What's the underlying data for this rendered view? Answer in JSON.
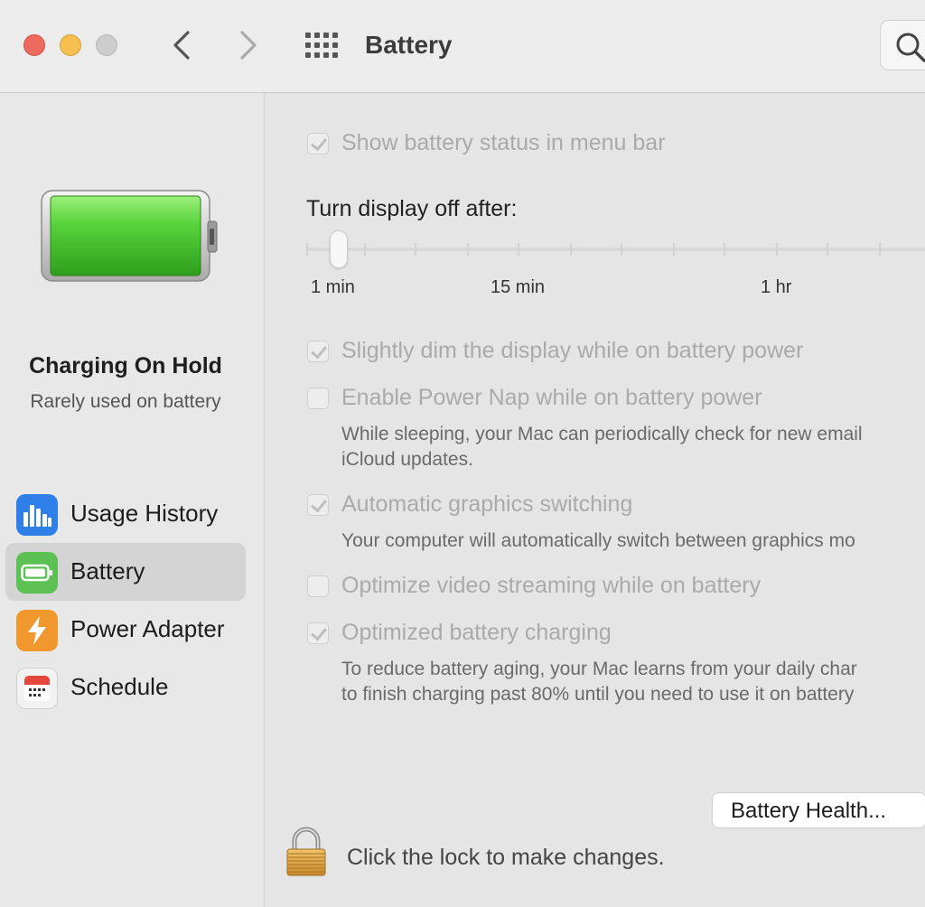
{
  "window": {
    "title": "Battery"
  },
  "sidebar": {
    "status_title": "Charging On Hold",
    "status_subtitle": "Rarely used on battery",
    "items": [
      {
        "label": "Usage History",
        "icon": "bar-chart-icon",
        "color": "#2f7fe8"
      },
      {
        "label": "Battery",
        "icon": "battery-icon",
        "color": "#5cc152",
        "selected": true
      },
      {
        "label": "Power Adapter",
        "icon": "lightning-icon",
        "color": "#f0982e"
      },
      {
        "label": "Schedule",
        "icon": "calendar-icon",
        "color": "#e5463c"
      }
    ]
  },
  "main": {
    "show_status": {
      "label": "Show battery status in menu bar",
      "checked": true
    },
    "display_off": {
      "label": "Turn display off after:",
      "tick_labels": [
        "1 min",
        "15 min",
        "1 hr"
      ],
      "value": "1 min"
    },
    "dim_display": {
      "label": "Slightly dim the display while on battery power",
      "checked": true
    },
    "power_nap": {
      "label": "Enable Power Nap while on battery power",
      "checked": false,
      "description_line1": "While sleeping, your Mac can periodically check for new email",
      "description_line2": "iCloud updates."
    },
    "graphics_switching": {
      "label": "Automatic graphics switching",
      "checked": true,
      "description": "Your computer will automatically switch between graphics mo"
    },
    "video_streaming": {
      "label": "Optimize video streaming while on battery",
      "checked": false
    },
    "optimized_charging": {
      "label": "Optimized battery charging",
      "checked": true,
      "description_line1": "To reduce battery aging, your Mac learns from your daily char",
      "description_line2": "to finish charging past 80% until you need to use it on battery"
    },
    "battery_health_button": "Battery Health...",
    "lock_text": "Click the lock to make changes."
  },
  "colors": {
    "close": "#ed6a5e",
    "minimize": "#f5bf4f",
    "zoom": "#cdcdcd",
    "battery_fill": "#55c93a"
  }
}
